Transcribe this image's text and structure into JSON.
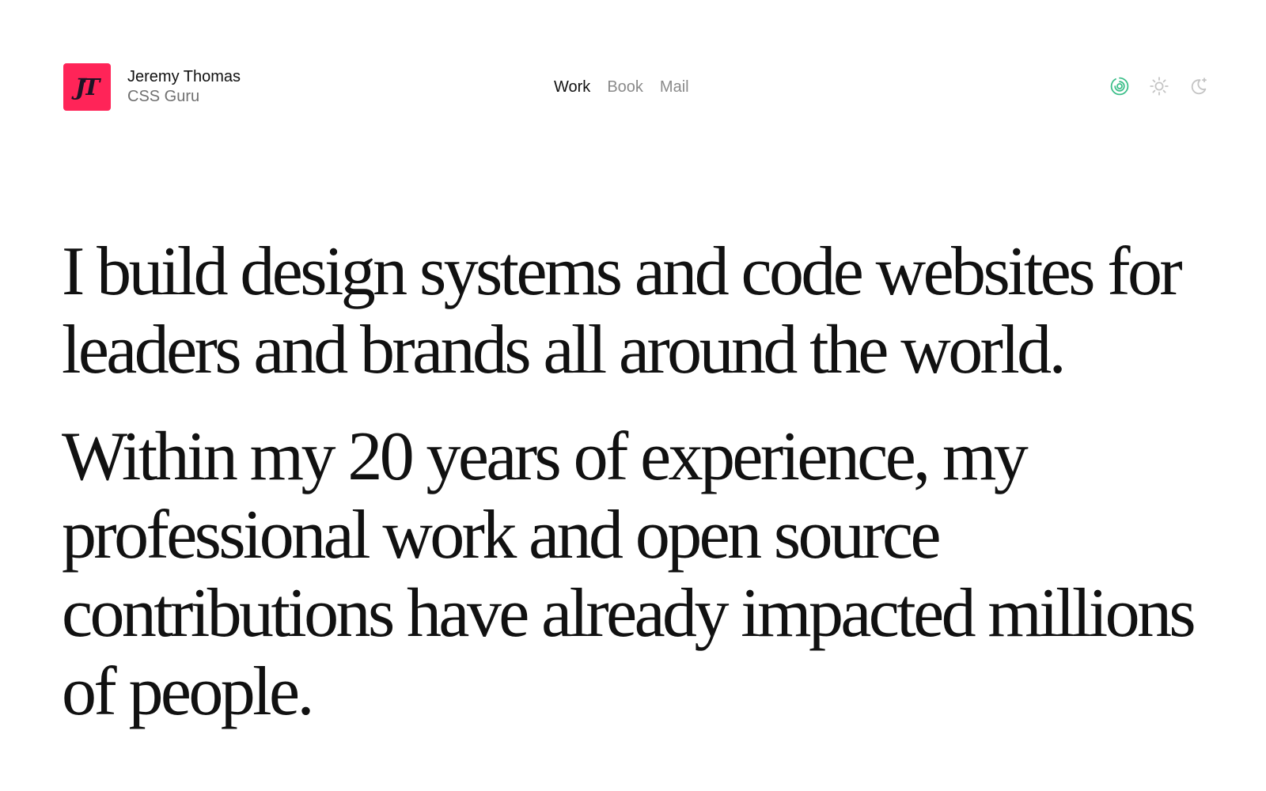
{
  "brand": {
    "logo_text": "JT",
    "name": "Jeremy Thomas",
    "role": "CSS Guru",
    "logo_color": "#ff2458"
  },
  "nav": {
    "items": [
      {
        "label": "Work",
        "active": true
      },
      {
        "label": "Book",
        "active": false
      },
      {
        "label": "Mail",
        "active": false
      }
    ]
  },
  "theme_switcher": {
    "icons": [
      "system-theme-icon",
      "sun-icon",
      "moon-icon"
    ],
    "active_color": "#3dbf8a",
    "inactive_color": "#c4c4c4"
  },
  "intro": {
    "paragraph_1": "I build design systems and code websites for leaders and brands all around the world.",
    "paragraph_2": "Within my 20 years of experience, my professional work and open source contributions have already impacted millions of people."
  }
}
